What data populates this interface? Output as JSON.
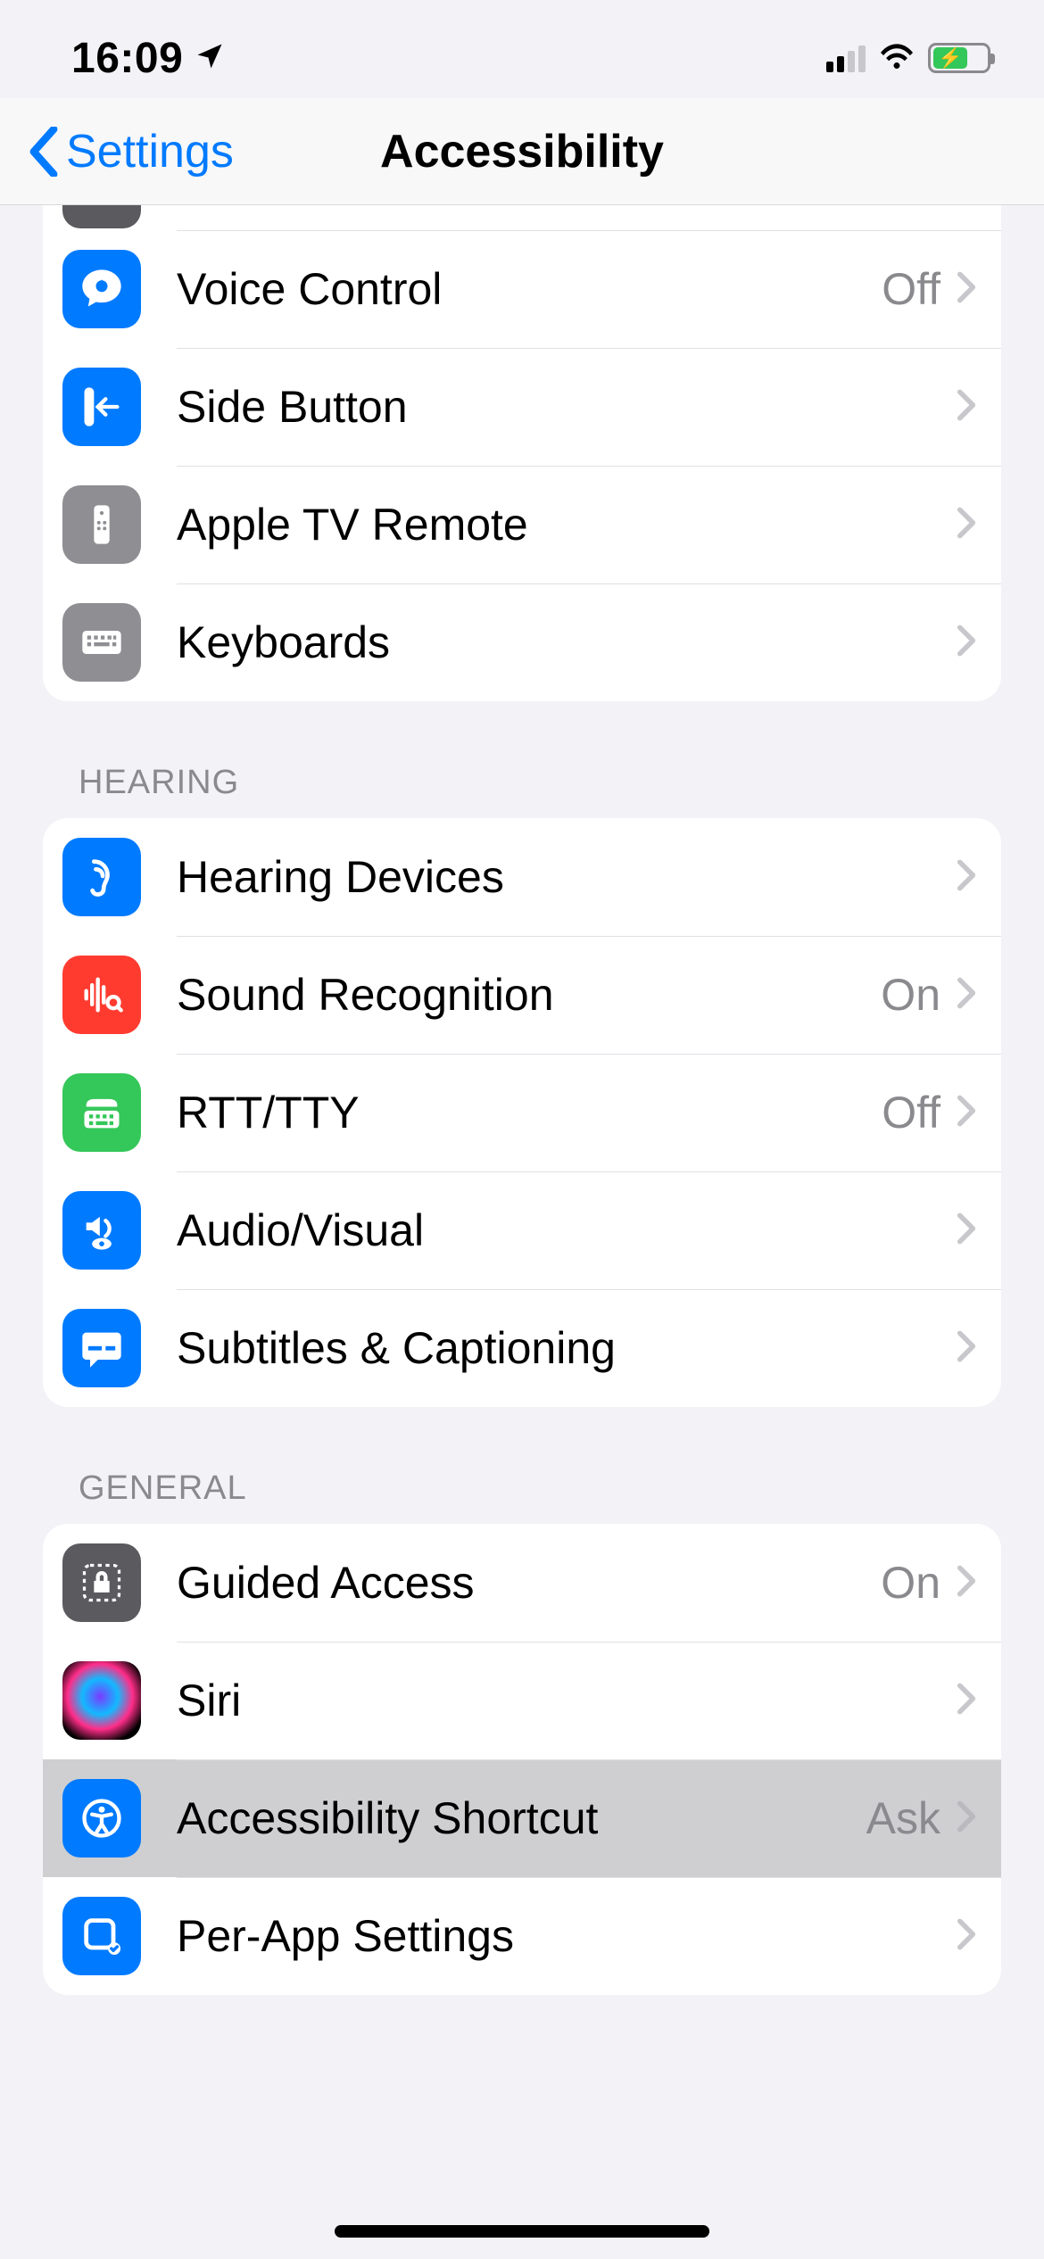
{
  "status": {
    "time": "16:09"
  },
  "nav": {
    "back": "Settings",
    "title": "Accessibility"
  },
  "sections": {
    "top": {
      "items": [
        {
          "label": "Voice Control",
          "value": "Off"
        },
        {
          "label": "Side Button",
          "value": ""
        },
        {
          "label": "Apple TV Remote",
          "value": ""
        },
        {
          "label": "Keyboards",
          "value": ""
        }
      ]
    },
    "hearing": {
      "header": "HEARING",
      "items": [
        {
          "label": "Hearing Devices",
          "value": ""
        },
        {
          "label": "Sound Recognition",
          "value": "On"
        },
        {
          "label": "RTT/TTY",
          "value": "Off"
        },
        {
          "label": "Audio/Visual",
          "value": ""
        },
        {
          "label": "Subtitles & Captioning",
          "value": ""
        }
      ]
    },
    "general": {
      "header": "GENERAL",
      "items": [
        {
          "label": "Guided Access",
          "value": "On"
        },
        {
          "label": "Siri",
          "value": ""
        },
        {
          "label": "Accessibility Shortcut",
          "value": "Ask"
        },
        {
          "label": "Per-App Settings",
          "value": ""
        }
      ]
    }
  }
}
